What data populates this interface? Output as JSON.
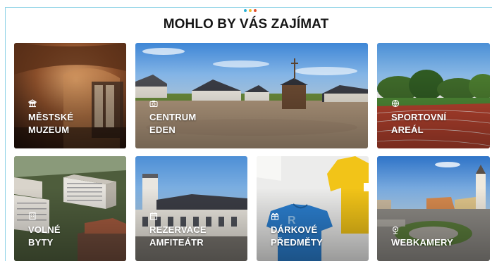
{
  "section": {
    "title": "MOHLO BY VÁS ZAJÍMAT"
  },
  "colors": {
    "dot1": "#2bb3d6",
    "dot2": "#f0b92b",
    "dot3": "#e2502f",
    "frame": "#8fd3e6"
  },
  "tiles": [
    {
      "line1": "MĚSTSKÉ",
      "line2": "MUZEUM",
      "icon": "museum-icon"
    },
    {
      "line1": "CENTRUM",
      "line2": "EDEN",
      "icon": "camera-icon"
    },
    {
      "line1": "SPORTOVNÍ",
      "line2": "AREÁL",
      "icon": "ball-icon"
    },
    {
      "line1": "VOLNÉ",
      "line2": "BYTY",
      "icon": "building-icon"
    },
    {
      "line1": "REZERVACE",
      "line2": "AMFITEÁTR",
      "icon": "calendar-icon"
    },
    {
      "line1": "DÁRKOVÉ",
      "line2": "PŘEDMĚTY",
      "icon": "gift-icon"
    },
    {
      "line1": "WEBKAMERY",
      "line2": "",
      "icon": "webcam-icon"
    }
  ]
}
